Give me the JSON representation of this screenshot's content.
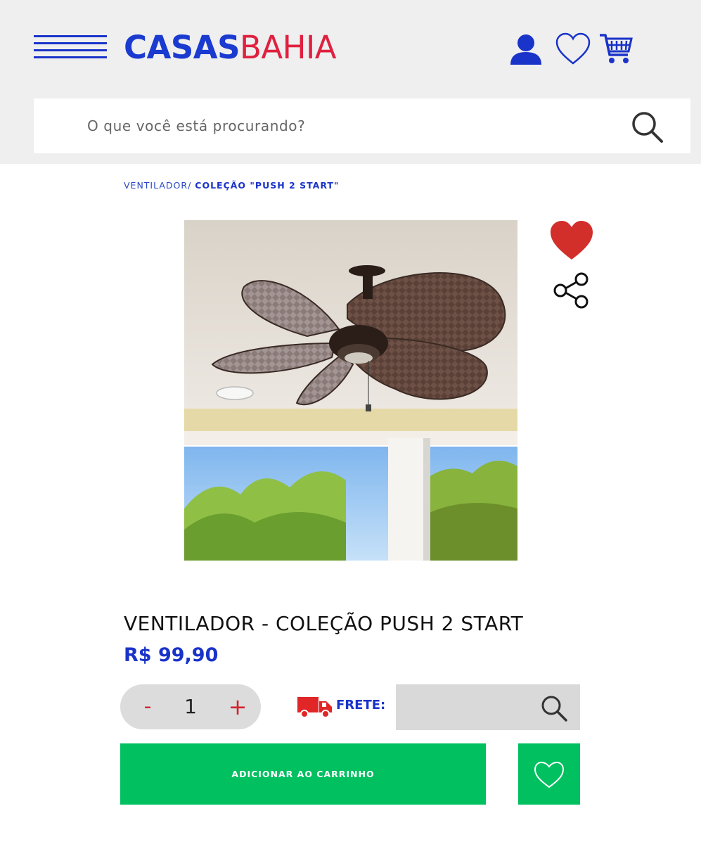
{
  "header": {
    "logo_part1": "CASAS",
    "logo_part2": "BAHIA",
    "menu_icon": "hamburger-menu-icon",
    "account_icon": "user-icon",
    "wishlist_icon": "heart-outline-icon",
    "cart_icon": "shopping-cart-icon",
    "brand_blue": "#1a33c9",
    "brand_red": "#e0203f"
  },
  "search": {
    "placeholder": "O que você está procurando?",
    "value": "",
    "icon": "search-icon"
  },
  "breadcrumb": {
    "parent": "VENTILADOR/",
    "current": "COLEÇÃO \"PUSH 2 START\""
  },
  "product": {
    "image_alt": "Ventilador de teto com pás de palha em varanda",
    "title": "VENTILADOR - COLEÇÃO PUSH 2 START",
    "price": "R$ 99,90",
    "favorite_icon": "heart-filled-icon",
    "favorite_color": "#d22f2a",
    "share_icon": "share-icon"
  },
  "quantity": {
    "minus_label": "-",
    "value": "1",
    "plus_label": "+"
  },
  "shipping": {
    "truck_icon": "delivery-truck-icon",
    "label": "FRETE:",
    "value": "",
    "search_icon": "search-icon"
  },
  "actions": {
    "add_to_cart_label": "ADICIONAR AO CARRINHO",
    "wishlist_icon": "heart-outline-icon",
    "button_color": "#00c060"
  }
}
